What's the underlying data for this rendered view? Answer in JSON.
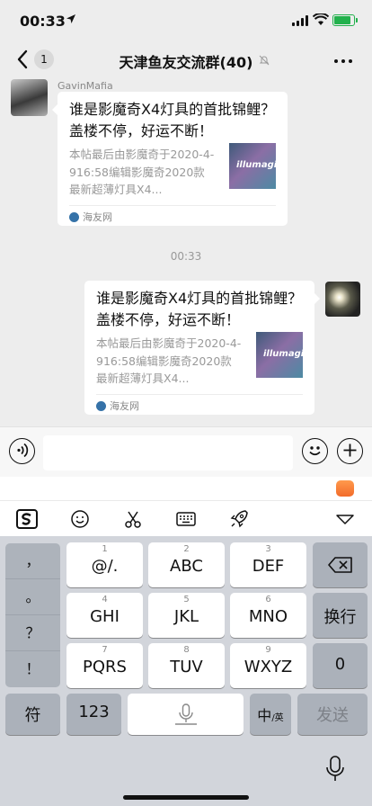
{
  "status": {
    "time": "00:33"
  },
  "nav": {
    "badge": "1",
    "title": "天津鱼友交流群(40)"
  },
  "messages": [
    {
      "sender": "GavinMafia",
      "title": "谁是影魔奇X4灯具的首批锦鲤？盖楼不停，好运不断！",
      "desc": "本帖最后由影魔奇于2020-4-916:58编辑影魔奇2020款最新超薄灯具X4...",
      "thumb_text": "illumagi",
      "source": "海友网"
    },
    {
      "title": "谁是影魔奇X4灯具的首批锦鲤？盖楼不停，好运不断！",
      "desc": "本帖最后由影魔奇于2020-4-916:58编辑影魔奇2020款最新超薄灯具X4...",
      "thumb_text": "illumagi",
      "source": "海友网"
    }
  ],
  "timestamp": "00:33",
  "input": {
    "placeholder": ""
  },
  "keyboard": {
    "punct": [
      "，",
      "。",
      "？",
      "！"
    ],
    "keys": [
      {
        "num": "1",
        "label": "@/."
      },
      {
        "num": "2",
        "label": "ABC"
      },
      {
        "num": "3",
        "label": "DEF"
      },
      {
        "num": "4",
        "label": "GHI"
      },
      {
        "num": "5",
        "label": "JKL"
      },
      {
        "num": "6",
        "label": "MNO"
      },
      {
        "num": "7",
        "label": "PQRS"
      },
      {
        "num": "8",
        "label": "TUV"
      },
      {
        "num": "9",
        "label": "WXYZ"
      }
    ],
    "newline": "换行",
    "zero": "0",
    "symbols": "符",
    "numbers": "123",
    "lang_main": "中",
    "lang_sub": "/英",
    "send": "发送"
  },
  "colors": {
    "battery": "#22b14c",
    "chat_bg": "#ededed",
    "keyboard_bg": "#d2d5db"
  }
}
